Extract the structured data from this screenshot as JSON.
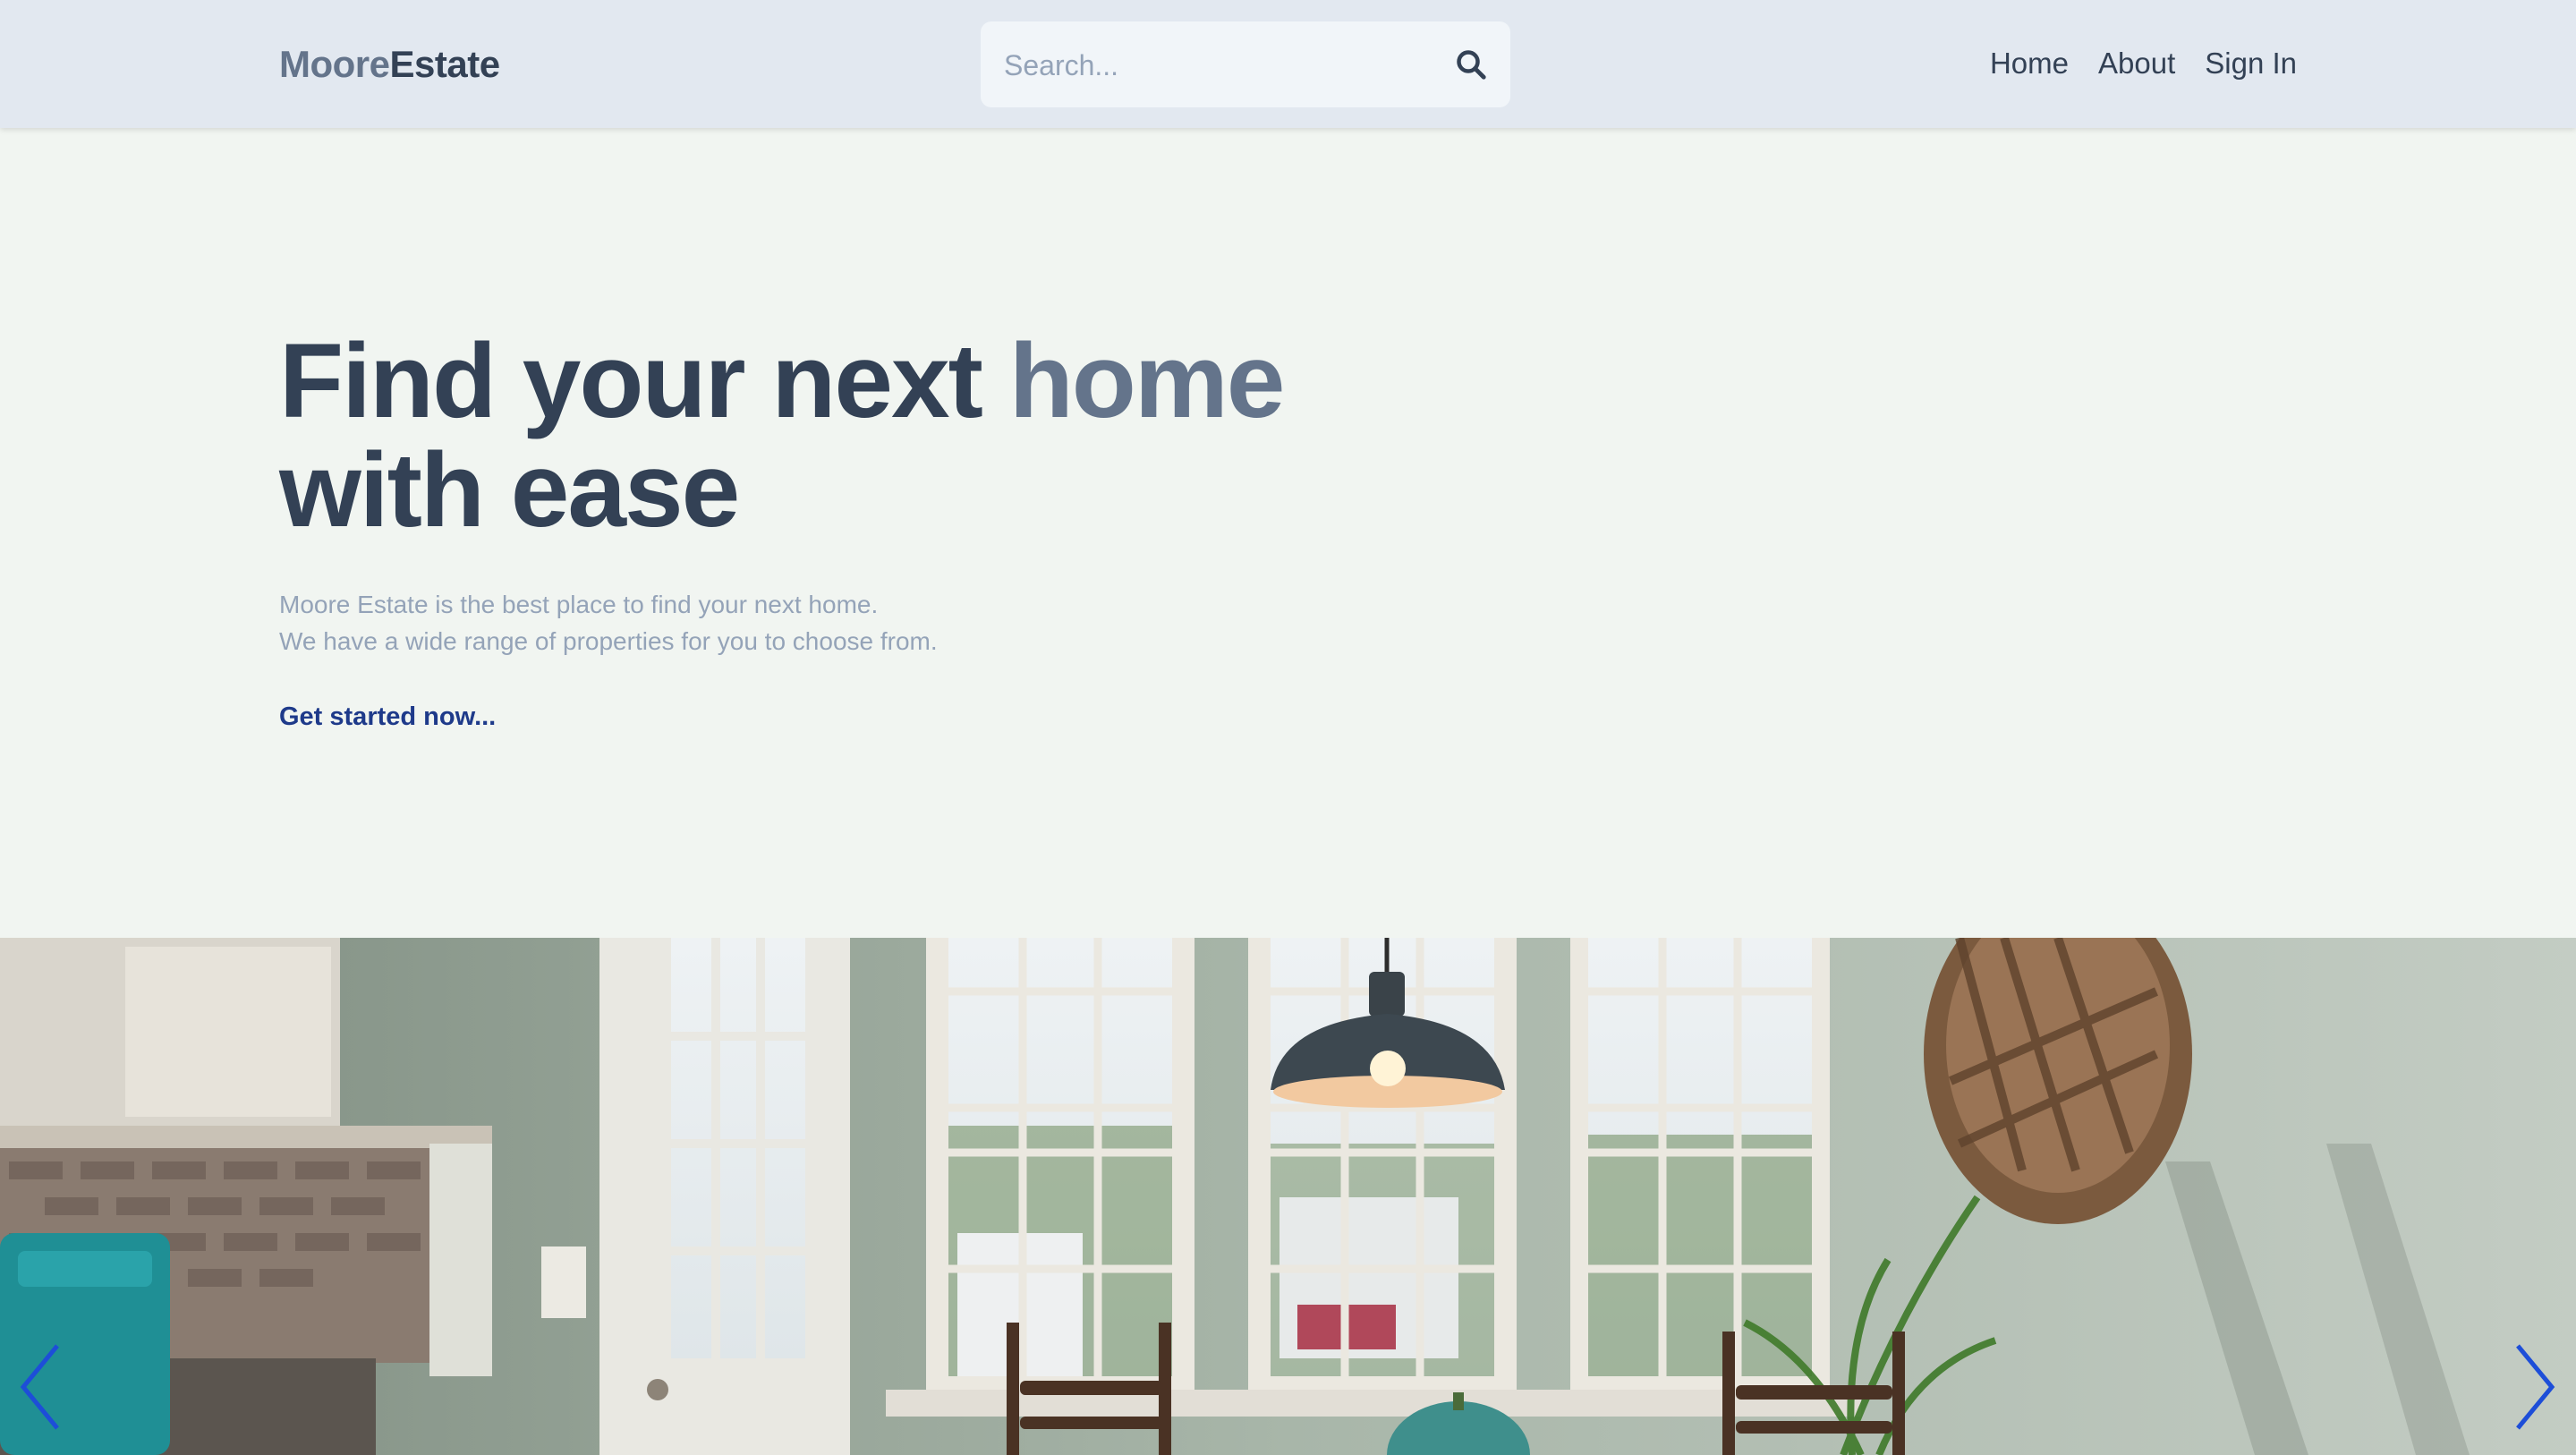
{
  "header": {
    "logo_part1": "Moore",
    "logo_part2": "Estate",
    "search_placeholder": "Search...",
    "search_icon": "search-icon",
    "nav": [
      {
        "label": "Home"
      },
      {
        "label": "About"
      },
      {
        "label": "Sign In"
      }
    ]
  },
  "hero": {
    "title_line1_start": "Find your next ",
    "title_accent": "home",
    "title_line2": "with ease",
    "description_line1": "Moore Estate is the best place to find your next home.",
    "description_line2": "We have a wide range of properties for you to choose from.",
    "cta_label": "Get started now..."
  },
  "carousel": {
    "prev_icon": "chevron-left-icon",
    "next_icon": "chevron-right-icon"
  },
  "colors": {
    "header_bg": "#e2e8f0",
    "page_bg": "#f1f5f1",
    "title": "#334155",
    "accent": "#64748b",
    "cta": "#1e3a8a",
    "arrow": "#1d4ed8"
  }
}
